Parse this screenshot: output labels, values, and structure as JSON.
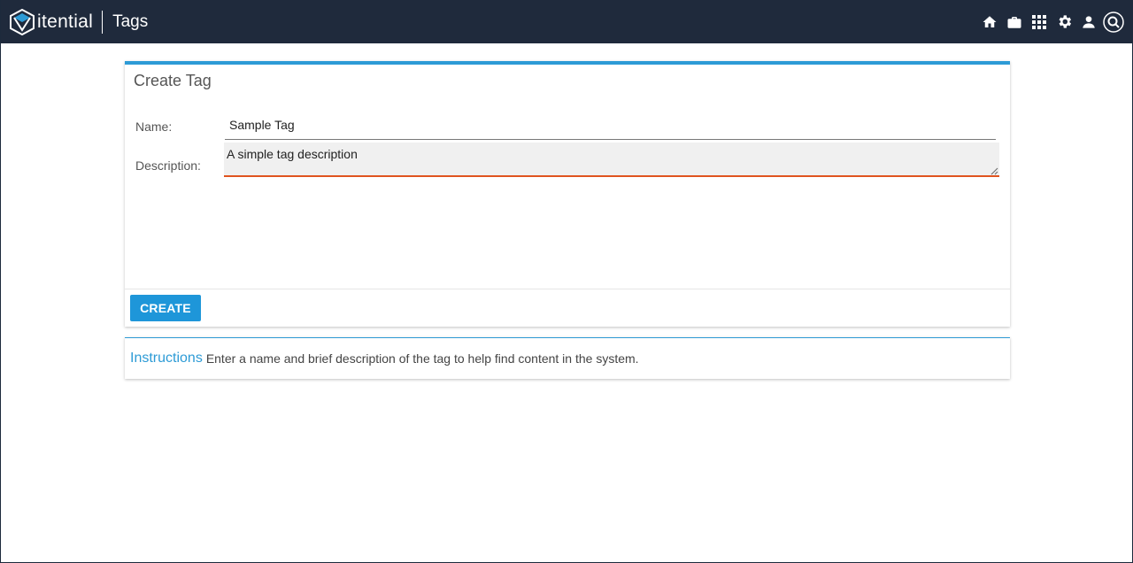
{
  "app": {
    "brand": "itential",
    "page_title": "Tags"
  },
  "topbar": {
    "icons": [
      "home-icon",
      "briefcase-icon",
      "apps-grid-icon",
      "gear-icon",
      "user-icon",
      "search-icon"
    ]
  },
  "form": {
    "title": "Create Tag",
    "name_label": "Name:",
    "name_value": "Sample Tag",
    "description_label": "Description:",
    "description_value": "A simple tag description",
    "create_label": "CREATE"
  },
  "instructions": {
    "label": "Instructions",
    "text": "Enter a name and brief description of the tag to help find content in the system."
  },
  "colors": {
    "topbar": "#1f2a3c",
    "accent": "#2d9bd6",
    "button": "#1e96d9",
    "focus_underline": "#e0541f"
  }
}
